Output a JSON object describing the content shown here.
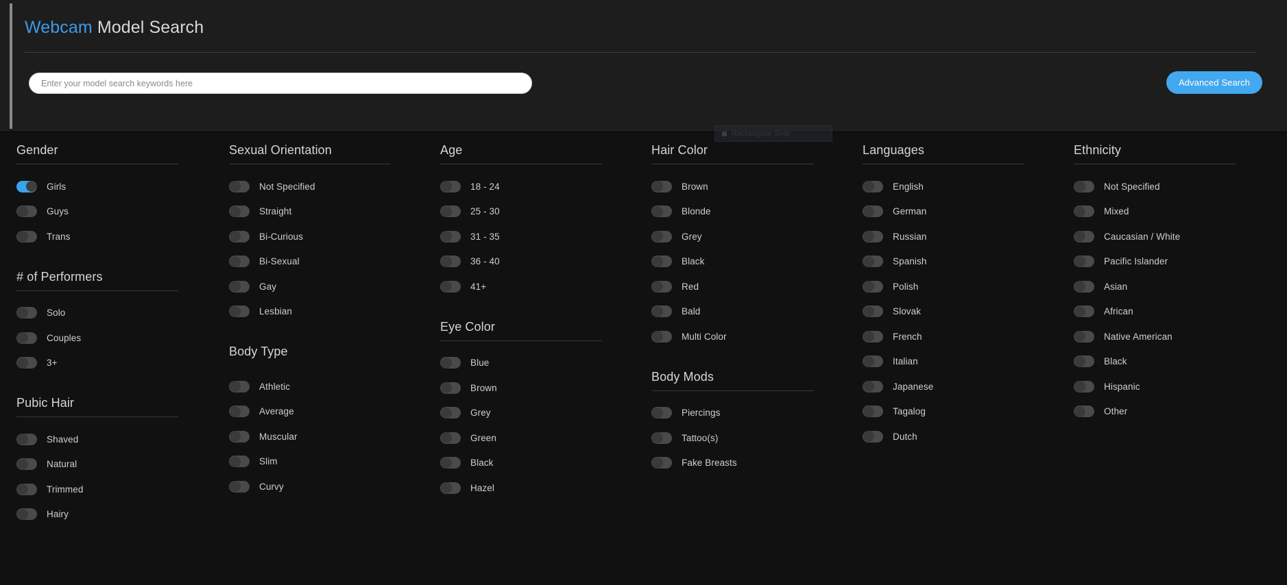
{
  "header": {
    "title_brand": "Webcam",
    "title_rest": " Model Search",
    "accent_color": "#3d9ae8"
  },
  "search": {
    "placeholder": "Enter your model search keywords here",
    "value": "",
    "advanced_button": "Advanced Search",
    "button_color": "#42a8ef"
  },
  "snip_overlay": {
    "label": "Rectangular Snip"
  },
  "columns": [
    {
      "groups": [
        {
          "title": "Gender",
          "rule": true,
          "options": [
            {
              "label": "Girls",
              "on": true
            },
            {
              "label": "Guys",
              "on": false
            },
            {
              "label": "Trans",
              "on": false
            }
          ]
        },
        {
          "title": "# of Performers",
          "rule": true,
          "options": [
            {
              "label": "Solo",
              "on": false
            },
            {
              "label": "Couples",
              "on": false
            },
            {
              "label": "3+",
              "on": false
            }
          ]
        },
        {
          "title": "Pubic Hair",
          "rule": true,
          "options": [
            {
              "label": "Shaved",
              "on": false
            },
            {
              "label": "Natural",
              "on": false
            },
            {
              "label": "Trimmed",
              "on": false
            },
            {
              "label": "Hairy",
              "on": false
            }
          ]
        }
      ]
    },
    {
      "groups": [
        {
          "title": "Sexual Orientation",
          "rule": true,
          "options": [
            {
              "label": "Not Specified",
              "on": false
            },
            {
              "label": "Straight",
              "on": false
            },
            {
              "label": "Bi-Curious",
              "on": false
            },
            {
              "label": "Bi-Sexual",
              "on": false
            },
            {
              "label": "Gay",
              "on": false
            },
            {
              "label": "Lesbian",
              "on": false
            }
          ]
        },
        {
          "title": "Body Type",
          "rule": false,
          "options": [
            {
              "label": "Athletic",
              "on": false
            },
            {
              "label": "Average",
              "on": false
            },
            {
              "label": "Muscular",
              "on": false
            },
            {
              "label": "Slim",
              "on": false
            },
            {
              "label": "Curvy",
              "on": false
            }
          ]
        }
      ]
    },
    {
      "groups": [
        {
          "title": "Age",
          "rule": true,
          "options": [
            {
              "label": "18 - 24",
              "on": false
            },
            {
              "label": "25 - 30",
              "on": false
            },
            {
              "label": "31 - 35",
              "on": false
            },
            {
              "label": "36 - 40",
              "on": false
            },
            {
              "label": "41+",
              "on": false
            }
          ]
        },
        {
          "title": "Eye Color",
          "rule": true,
          "options": [
            {
              "label": "Blue",
              "on": false
            },
            {
              "label": "Brown",
              "on": false
            },
            {
              "label": "Grey",
              "on": false
            },
            {
              "label": "Green",
              "on": false
            },
            {
              "label": "Black",
              "on": false
            },
            {
              "label": "Hazel",
              "on": false
            }
          ]
        }
      ]
    },
    {
      "groups": [
        {
          "title": "Hair Color",
          "rule": true,
          "options": [
            {
              "label": "Brown",
              "on": false
            },
            {
              "label": "Blonde",
              "on": false
            },
            {
              "label": "Grey",
              "on": false
            },
            {
              "label": "Black",
              "on": false
            },
            {
              "label": "Red",
              "on": false
            },
            {
              "label": "Bald",
              "on": false
            },
            {
              "label": "Multi Color",
              "on": false
            }
          ]
        },
        {
          "title": "Body Mods",
          "rule": true,
          "options": [
            {
              "label": "Piercings",
              "on": false
            },
            {
              "label": "Tattoo(s)",
              "on": false
            },
            {
              "label": "Fake Breasts",
              "on": false
            }
          ]
        }
      ]
    },
    {
      "groups": [
        {
          "title": "Languages",
          "rule": true,
          "options": [
            {
              "label": "English",
              "on": false
            },
            {
              "label": "German",
              "on": false
            },
            {
              "label": "Russian",
              "on": false
            },
            {
              "label": "Spanish",
              "on": false
            },
            {
              "label": "Polish",
              "on": false
            },
            {
              "label": "Slovak",
              "on": false
            },
            {
              "label": "French",
              "on": false
            },
            {
              "label": "Italian",
              "on": false
            },
            {
              "label": "Japanese",
              "on": false
            },
            {
              "label": "Tagalog",
              "on": false
            },
            {
              "label": "Dutch",
              "on": false
            }
          ]
        }
      ]
    },
    {
      "groups": [
        {
          "title": "Ethnicity",
          "rule": true,
          "options": [
            {
              "label": "Not Specified",
              "on": false
            },
            {
              "label": "Mixed",
              "on": false
            },
            {
              "label": "Caucasian / White",
              "on": false
            },
            {
              "label": "Pacific Islander",
              "on": false
            },
            {
              "label": "Asian",
              "on": false
            },
            {
              "label": "African",
              "on": false
            },
            {
              "label": "Native American",
              "on": false
            },
            {
              "label": "Black",
              "on": false
            },
            {
              "label": "Hispanic",
              "on": false
            },
            {
              "label": "Other",
              "on": false
            }
          ]
        }
      ]
    }
  ]
}
